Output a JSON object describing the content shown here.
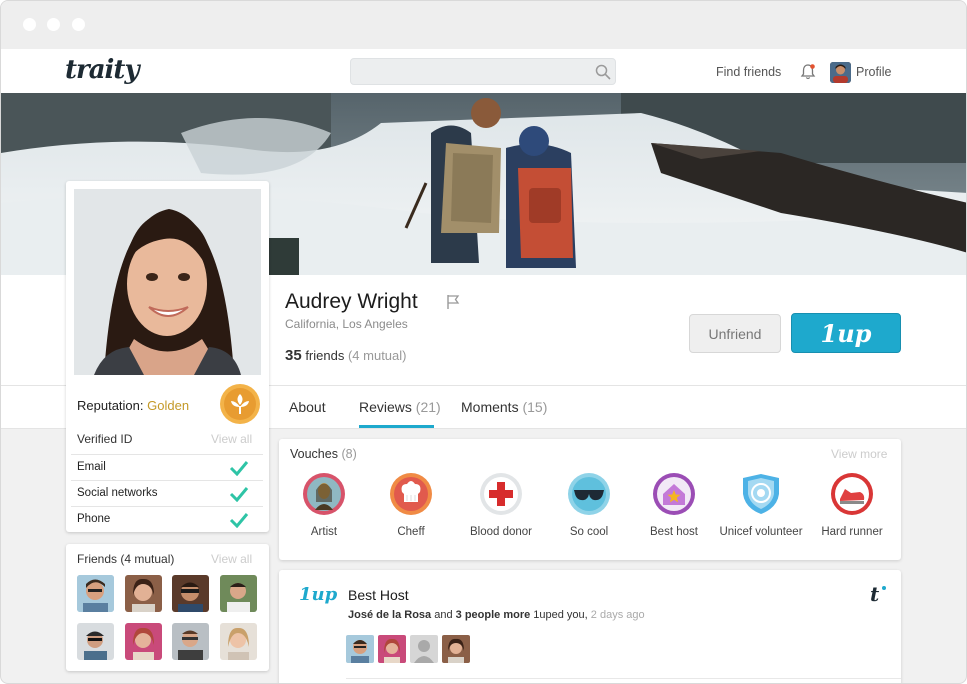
{
  "nav": {
    "logo": "traity",
    "search_placeholder": "",
    "find_friends": "Find friends",
    "profile": "Profile"
  },
  "profile": {
    "name": "Audrey Wright",
    "location": "California, Los Angeles",
    "friends_count": "35",
    "friends_label": "friends",
    "mutual": "(4 mutual)",
    "unfriend": "Unfriend",
    "oneup": "1up"
  },
  "reputation": {
    "label": "Reputation:",
    "level": "Golden"
  },
  "verified": {
    "title": "Verified ID",
    "view_all": "View all",
    "items": [
      "Email",
      "Social networks",
      "Phone"
    ]
  },
  "friends_box": {
    "title": "Friends (4 mutual)",
    "view_all": "View all"
  },
  "tabs": [
    {
      "label": "About",
      "count": ""
    },
    {
      "label": "Reviews",
      "count": "(21)"
    },
    {
      "label": "Moments",
      "count": "(15)"
    }
  ],
  "vouches": {
    "title": "Vouches",
    "count": "(8)",
    "view_more": "View more",
    "items": [
      "Artist",
      "Cheff",
      "Blood donor",
      "So cool",
      "Best host",
      "Unicef volunteer",
      "Hard runner"
    ]
  },
  "review": {
    "logo": "1up",
    "title": "Best Host",
    "author": "José de la Rosa",
    "and": "and",
    "others": "3 people more",
    "action": "1uped you,",
    "ago": "2 days ago",
    "brand_icon": "t"
  },
  "colors": {
    "accent": "#1ea9cd",
    "golden": "#c49a28",
    "check": "#2ec4a6"
  }
}
